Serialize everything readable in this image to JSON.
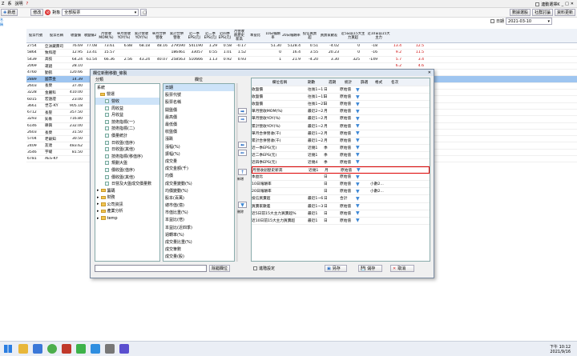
{
  "menu": {
    "item1": "Z",
    "item2": "系",
    "item3": "說明",
    "item4": "?"
  },
  "toolbar": {
    "new": "新增",
    "new2": "修改",
    "account_label": "對象",
    "account_value": "全部股票",
    "date_label": "日期",
    "date_value": "2021-03-10",
    "check_label": "連動選擇K",
    "btn1": "數據選股",
    "btn2": "社群討論",
    "btn3": "資料更新"
  },
  "lefttabs": {
    "t1": "名",
    "t2": "稱"
  },
  "grid": {
    "headers": [
      "股票代號",
      "股票名稱",
      "收盤價",
      "收盤價2",
      "月營收MOM(%)",
      "單月營收YOY(%)",
      "累計營收YOY(%)",
      "單月合併營收",
      "累計合併營收",
      "近一季EPS(元)",
      "近二季EPS(元)",
      "近四季EPS(元)",
      "月營收創歷史新高",
      "本益比",
      "10日報酬率",
      "20日報酬率",
      "投信買賣超",
      "買賣家數差",
      "近5日前15大主力買超",
      "近10日前15大主力"
    ],
    "rows": [
      [
        "2754",
        "亞洲藏壽司",
        "76.69",
        "77.08",
        "73.61",
        "6.88",
        "68.18",
        "48.16",
        "279590",
        "541190",
        "1.29",
        "0.58",
        "-0.17",
        "",
        "51.30",
        "5128.4",
        "0.51",
        "-4.02",
        "0",
        "-18",
        "13.4",
        "12.5"
      ],
      [
        "5864",
        "致和證",
        "12.95",
        "13.41",
        "15.57",
        "",
        "",
        "",
        "186461",
        "33057",
        "0.55",
        "1.01",
        "1.52",
        "",
        "0",
        "16.4",
        "3.55",
        "20.23",
        "0",
        "-16",
        "9.2",
        "11.5"
      ],
      [
        "5439",
        "高技",
        "64.24",
        "61.54",
        "66.36",
        "2.56",
        "43.24",
        "40.07",
        "258563",
        "510666",
        "1.13",
        "0.92",
        "0.93",
        "",
        "1",
        "21.9",
        "-4.20",
        "3.30",
        "325",
        "-149",
        "5.7",
        "3.4"
      ],
      [
        "2069",
        "運錩",
        "28.10",
        "",
        "",
        "",
        "",
        "",
        "",
        "",
        "",
        "",
        "",
        "",
        "",
        "",
        "",
        "",
        "",
        "",
        "6.2",
        "4.6"
      ],
      [
        "4760",
        "勤凱",
        "120.66",
        "",
        "",
        "",
        "",
        "",
        "",
        "",
        "",
        "",
        "",
        "",
        "",
        "",
        "",
        "",
        "",
        "",
        "1.3",
        "0.5"
      ],
      [
        "2889",
        "國票金",
        "14.39",
        "",
        "",
        "",
        "",
        "",
        "",
        "",
        "",
        "",
        "",
        "",
        "",
        "",
        "",
        "",
        "",
        "",
        "0.4",
        "0.4"
      ],
      [
        "2603",
        "長榮",
        "37.40",
        "",
        "",
        "",
        "",
        "",
        "",
        "",
        "",
        "",
        "",
        "",
        "",
        "",
        "",
        "",
        "",
        "",
        "0.1",
        "0.4"
      ],
      [
        "3228",
        "金麗科",
        "410.00",
        "",
        "",
        "",
        "",
        "",
        "",
        "",
        "",
        "",
        "",
        "",
        "",
        "",
        "",
        "",
        "",
        "",
        "3.6",
        "2.2"
      ],
      [
        "6015",
        "宏遠證",
        "23.00",
        "",
        "",
        "",
        "",
        "",
        "",
        "",
        "",
        "",
        "",
        "",
        "",
        "",
        "",
        "",
        "",
        "",
        "0.3",
        "3.3"
      ],
      [
        "3661",
        "世芯-KY",
        "905.18",
        "",
        "",
        "",
        "",
        "",
        "",
        "",
        "",
        "",
        "",
        "",
        "",
        "",
        "",
        "",
        "",
        "",
        "-4.3",
        "4.6"
      ],
      [
        "6712",
        "長聖",
        "357.50",
        "",
        "",
        "",
        "",
        "",
        "",
        "",
        "",
        "",
        "",
        "",
        "",
        "",
        "",
        "",
        "",
        "",
        "-6",
        "5.4"
      ],
      [
        "3293",
        "鈊象",
        "716.80",
        "",
        "",
        "",
        "",
        "",
        "",
        "",
        "",
        "",
        "",
        "",
        "",
        "",
        "",
        "",
        "",
        "",
        "-1.6",
        "5.8"
      ],
      [
        "6146",
        "耕興",
        "232.00",
        "",
        "",
        "",
        "",
        "",
        "",
        "",
        "",
        "",
        "",
        "",
        "",
        "",
        "",
        "",
        "",
        "",
        "9.7",
        "6.3"
      ],
      [
        "2603",
        "長榮",
        "31.50",
        "",
        "",
        "",
        "",
        "",
        "",
        "",
        "",
        "",
        "",
        "",
        "",
        "",
        "",
        "",
        "",
        "",
        "-9.3",
        "9.6"
      ],
      [
        "5704",
        "老爺知",
        "30.50",
        "",
        "",
        "",
        "",
        "",
        "",
        "",
        "",
        "",
        "",
        "",
        "",
        "",
        "",
        "",
        "",
        "",
        "-12.9",
        "9.3"
      ],
      [
        "2409",
        "友達",
        "483.62",
        "",
        "",
        "",
        "",
        "",
        "",
        "",
        "",
        "",
        "",
        "",
        "",
        "",
        "",
        "",
        "",
        "",
        "-9.7",
        "8.1"
      ],
      [
        "3546",
        "宇峻",
        "81.50",
        "",
        "",
        "",
        "",
        "",
        "",
        "",
        "",
        "",
        "",
        "",
        "",
        "",
        "",
        "",
        "",
        "",
        "-12.2",
        "12.2"
      ],
      [
        "6781",
        "AES-KY",
        "",
        "",
        "",
        "",
        "",
        "",
        "",
        "",
        "",
        "",
        "",
        "",
        "",
        "",
        "",
        "",
        "",
        "",
        "",
        ""
      ]
    ]
  },
  "dialog": {
    "title": "欄位新刪移動_條製",
    "tab_left": "分類",
    "tab_mid": "欄位",
    "cat_label": "系統",
    "cats": [
      "營運",
      "營收",
      "周收益",
      "月收益",
      "技術指標(一)",
      "技術指標(二)",
      "價量統計",
      "日收盤(值序)",
      "日收盤(其他)",
      "技術指標(移值序)",
      "規劃大盤",
      "價收盤(值序)",
      "價收盤(其他)",
      "日營及大盤成交價量數"
    ],
    "folders": [
      "籌碼",
      "財務",
      "公司資訊",
      "產業分析",
      "temp"
    ],
    "fields": [
      "日期",
      "股票代號",
      "股票名稱",
      "開盤價",
      "最高價",
      "最低價",
      "收盤價",
      "漲跌",
      "漲幅(%)",
      "振幅(%)",
      "成交量",
      "成交金額(千)",
      "均價",
      "成交量變動(%)",
      "均價變動(%)",
      "股本(百萬)",
      "總市值(億)",
      "市值比重(%)",
      "本益比(倍)",
      "本益比(近四季)",
      "週轉率(%)",
      "成交量比重(%)",
      "成交筆數",
      "成交量(股)"
    ],
    "arrow_labels": [
      "新增",
      "刪除",
      "移動"
    ],
    "right_headers": [
      "欄位名稱",
      "期數",
      "週期",
      "統計",
      "篩選",
      "格式",
      "名次"
    ],
    "right_rows": [
      [
        "收盤價",
        "往後1~1",
        "日",
        "原始值"
      ],
      [
        "收盤價",
        "往後1~11",
        "日",
        "原始值"
      ],
      [
        "收盤價",
        "往後1~21",
        "日",
        "原始值"
      ],
      [
        "單月營收MOM(%)",
        "最近2~2",
        "月",
        "原始值"
      ],
      [
        "單月營收YOY(%)",
        "最近1~2",
        "月",
        "原始值"
      ],
      [
        "累計營收YOY(%)",
        "最近1~2",
        "月",
        "原始值"
      ],
      [
        "單月合併營收(千)",
        "最近1~2",
        "月",
        "原始值"
      ],
      [
        "累計合併營收(千)",
        "最近1~2",
        "月",
        "原始值"
      ],
      [
        "近一季EPS(元)",
        "近幾1",
        "季",
        "原始值"
      ],
      [
        "近二季EPS(元)",
        "近幾1",
        "季",
        "原始值"
      ],
      [
        "近四季EPS(元)",
        "近幾4",
        "季",
        "原始值"
      ],
      [
        "月營收創歷史新高",
        "近幾1",
        "月",
        "原始值"
      ],
      [
        "本益比",
        "",
        "日",
        "原始值"
      ],
      [
        "10日報酬率",
        "",
        "日",
        "原始值"
      ],
      [
        "20日報酬率",
        "",
        "日",
        "原始值"
      ],
      [
        "投信買賣超",
        "最近1~6",
        "日",
        "合計"
      ],
      [
        "買賣家數差",
        "最近1~3",
        "日",
        "原始值"
      ],
      [
        "近5日前15大主力買賣超%",
        "最近1",
        "日",
        "原始值"
      ],
      [
        "近10日前15大主力買賣超",
        "最近1",
        "日",
        "原始值"
      ]
    ],
    "extra": [
      "小數2...",
      "小數2..."
    ],
    "search_btn": "除錯欄位",
    "check_label": "進階設定",
    "save_btn": "另存",
    "ok_btn": "儲存",
    "cancel_btn": "取消",
    "refresh_label": "新增"
  },
  "taskbar": {
    "time": "下午 10:12",
    "date": "2021/9/16"
  }
}
